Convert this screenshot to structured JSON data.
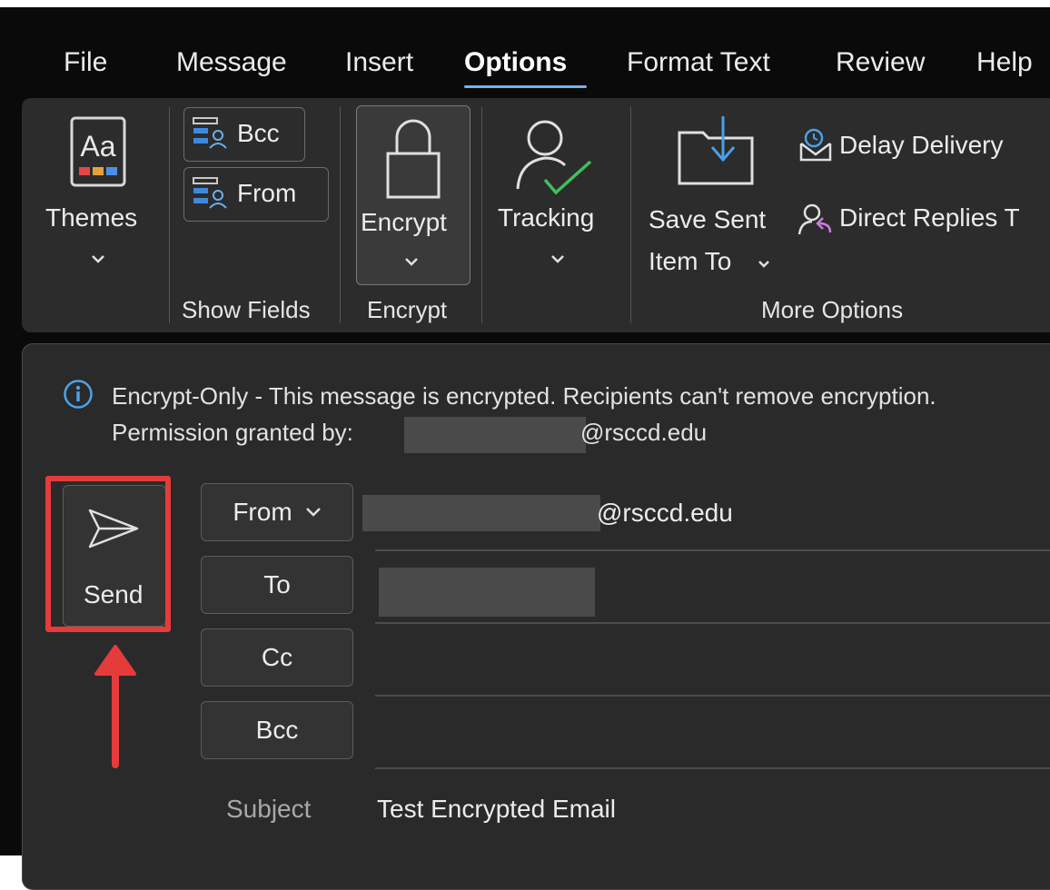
{
  "menu": {
    "items": [
      "File",
      "Message",
      "Insert",
      "Options",
      "Format Text",
      "Review",
      "Help"
    ],
    "active": "Options"
  },
  "ribbon": {
    "themes": {
      "label": "Themes"
    },
    "show_fields": {
      "bcc_label": "Bcc",
      "from_label": "From",
      "group_label": "Show Fields"
    },
    "encrypt": {
      "label": "Encrypt",
      "group_label": "Encrypt"
    },
    "tracking": {
      "label": "Tracking"
    },
    "more_options": {
      "save_sent_line1": "Save Sent",
      "save_sent_line2": "Item To",
      "delay_delivery": "Delay Delivery",
      "direct_replies": "Direct Replies T",
      "group_label": "More Options"
    }
  },
  "infobar": {
    "line1": "Encrypt-Only - This message is encrypted. Recipients can't remove encryption.",
    "line2_prefix": "Permission granted by: ",
    "line2_suffix": "@rsccd.edu"
  },
  "compose": {
    "send_label": "Send",
    "from_button": "From",
    "from_value": "@rsccd.edu",
    "to_button": "To",
    "cc_button": "Cc",
    "bcc_button": "Bcc",
    "subject_label": "Subject",
    "subject_value": "Test Encrypted Email"
  },
  "colors": {
    "accent_blue": "#7ab1e8",
    "highlight_red": "#e63b3b",
    "tracking_check_green": "#3fbf5a",
    "info_icon_blue": "#4ea3e8"
  }
}
